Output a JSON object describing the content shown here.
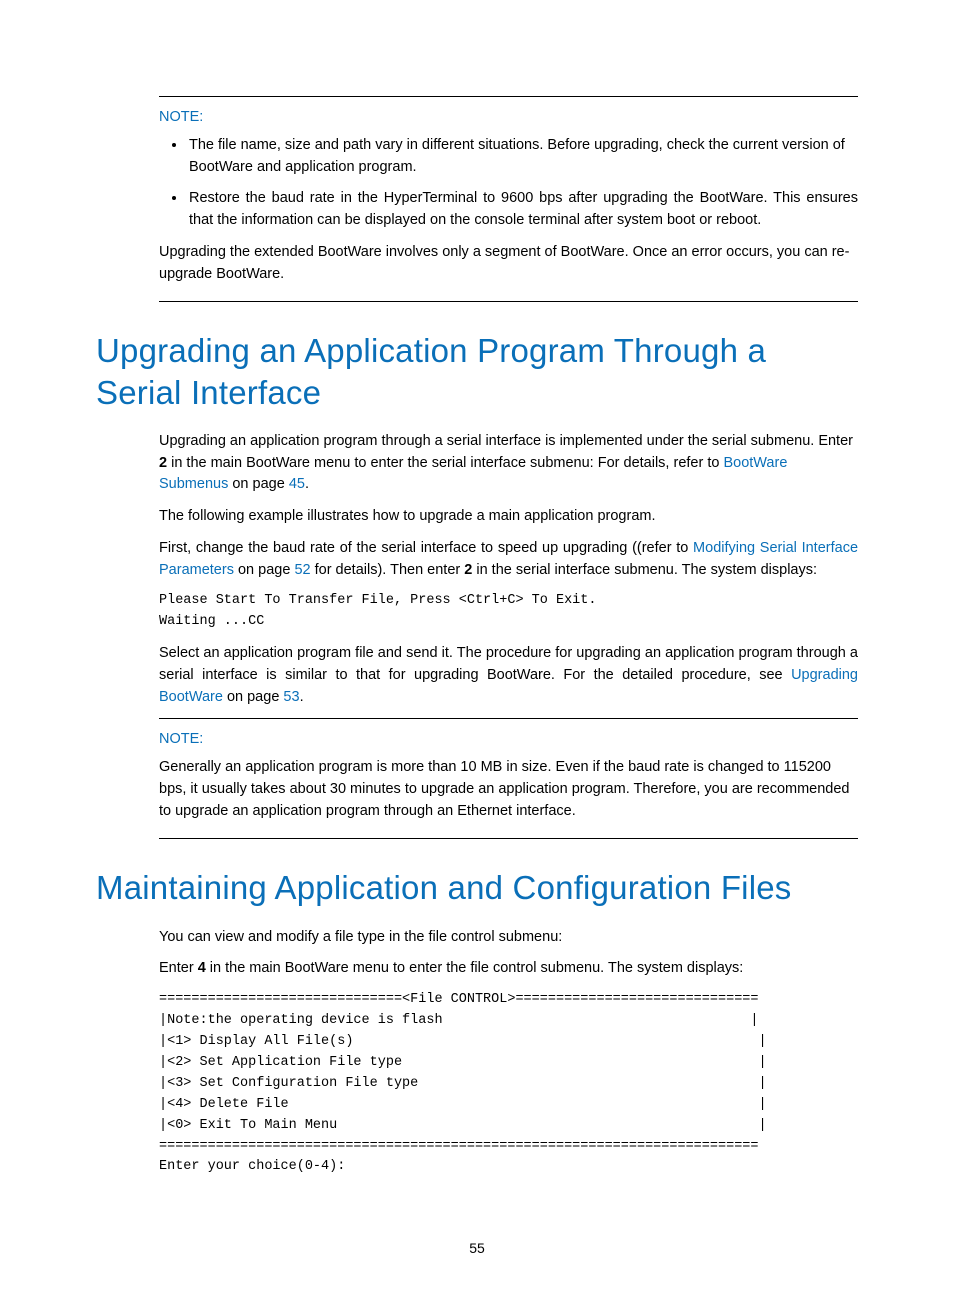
{
  "note1": {
    "label": "NOTE:",
    "bullets": [
      "The file name, size and path vary in different situations. Before upgrading, check the current version of BootWare and application program.",
      "Restore the baud rate in the HyperTerminal to 9600 bps after upgrading the BootWare. This ensures that the information can be displayed on the console terminal after system boot or reboot."
    ],
    "tail": "Upgrading the extended BootWare involves only a segment of BootWare. Once an error occurs, you can re-upgrade BootWare."
  },
  "heading1": "Upgrading an Application Program Through a Serial Interface",
  "p1_a": "Upgrading an application program through a serial interface is implemented under the serial submenu. Enter ",
  "p1_bold": "2",
  "p1_b": " in the main BootWare menu to enter the serial interface submenu: For details, refer to ",
  "p1_link1": "BootWare Submenus",
  "p1_c": " on page ",
  "p1_link2": "45",
  "p1_d": ".",
  "p2": "The following example illustrates how to upgrade a main application program.",
  "p3_a": "First, change the baud rate of the serial interface to speed up upgrading ((refer to ",
  "p3_link1": "Modifying Serial Interface Parameters",
  "p3_b": " on page ",
  "p3_link2": "52",
  "p3_c": " for details). Then enter ",
  "p3_bold": "2",
  "p3_d": " in the serial interface submenu. The system displays:",
  "code1": "Please Start To Transfer File, Press <Ctrl+C> To Exit.\nWaiting ...CC",
  "p4_a": "Select an application program file and send it. The procedure for upgrading an application program through a serial interface is similar to that for upgrading BootWare. For the detailed procedure, see ",
  "p4_link1": "Upgrading BootWare",
  "p4_b": " on page ",
  "p4_link2": "53",
  "p4_c": ".",
  "note2": {
    "label": "NOTE:",
    "text": "Generally an application program is more than 10 MB in size. Even if the baud rate is changed to 115200 bps, it usually takes about 30 minutes to upgrade an application program. Therefore, you are recommended to upgrade an application program through an Ethernet interface."
  },
  "heading2": "Maintaining Application and Configuration Files",
  "p5": "You can view and modify a file type in the file control submenu:",
  "p6_a": "Enter ",
  "p6_bold": "4",
  "p6_b": " in the main BootWare menu to enter the file control submenu. The system displays:",
  "code2": "==============================<File CONTROL>==============================\n|Note:the operating device is flash                                      |\n|<1> Display All File(s)                                                  |\n|<2> Set Application File type                                            |\n|<3> Set Configuration File type                                          |\n|<4> Delete File                                                          |\n|<0> Exit To Main Menu                                                    |\n==========================================================================\nEnter your choice(0-4):",
  "page_number": "55"
}
